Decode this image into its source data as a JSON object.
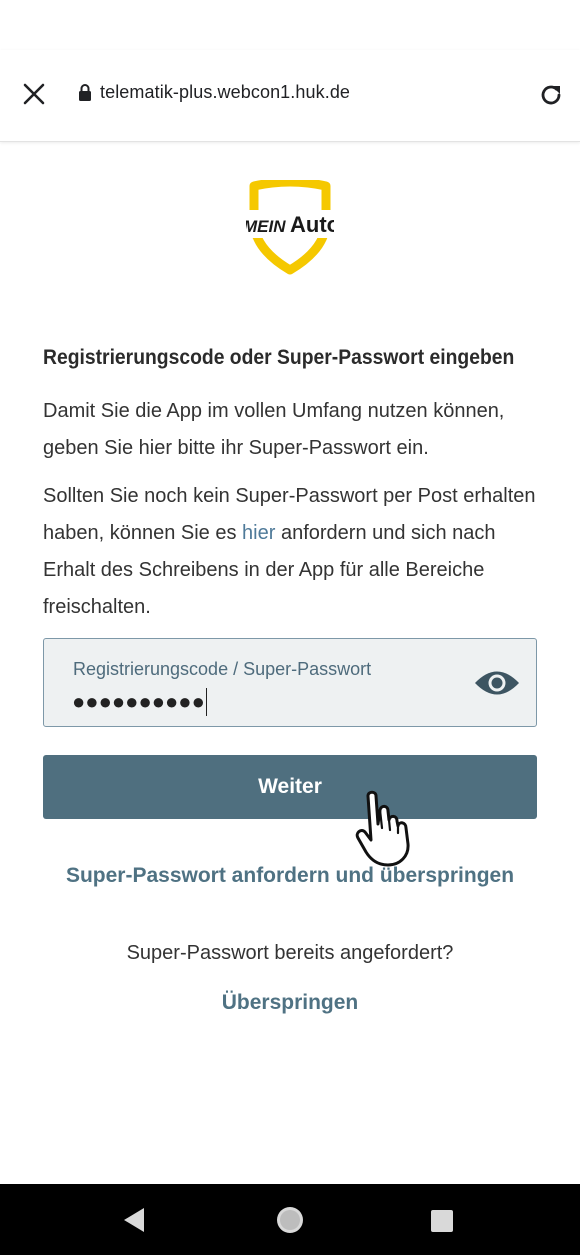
{
  "browser": {
    "url": "telematik-plus.webcon1.huk.de",
    "close_icon": "close-icon",
    "lock_icon": "lock-icon",
    "reload_icon": "reload-icon"
  },
  "logo": {
    "word1": "MEIN",
    "word2": "Auto",
    "shield_color": "#f5c800"
  },
  "content": {
    "heading": "Registrierungscode oder Super-Passwort eingeben",
    "para1": "Damit Sie die App im vollen Umfang nutzen können, geben Sie hier bitte ihr Super-Passwort ein.",
    "para2_before": "Sollten Sie noch kein Super-Passwort per Post erhal­ten haben, können Sie es ",
    "para2_link": "hier",
    "para2_after": " anfordern und sich nach Erhalt des Schreibens in der App für alle Bereiche freischalten."
  },
  "password_field": {
    "label": "Registrierungscode / Super-Passwort",
    "masked_value": "●●●●●●●●●●",
    "visibility_icon": "eye-icon"
  },
  "actions": {
    "weiter": "Weiter",
    "request_and_skip": "Super-Passwort anfordern und überspringen",
    "already_requested": "Super-Passwort bereits angefordert?",
    "skip": "Überspringen"
  },
  "colors": {
    "primary_button": "#4f6f7f",
    "link": "#4f7283",
    "inline_link": "#4f7a99",
    "field_bg": "#eef1f2"
  },
  "nav": {
    "back_icon": "back-triangle-icon",
    "home_icon": "home-circle-icon",
    "recents_icon": "recents-square-icon"
  }
}
